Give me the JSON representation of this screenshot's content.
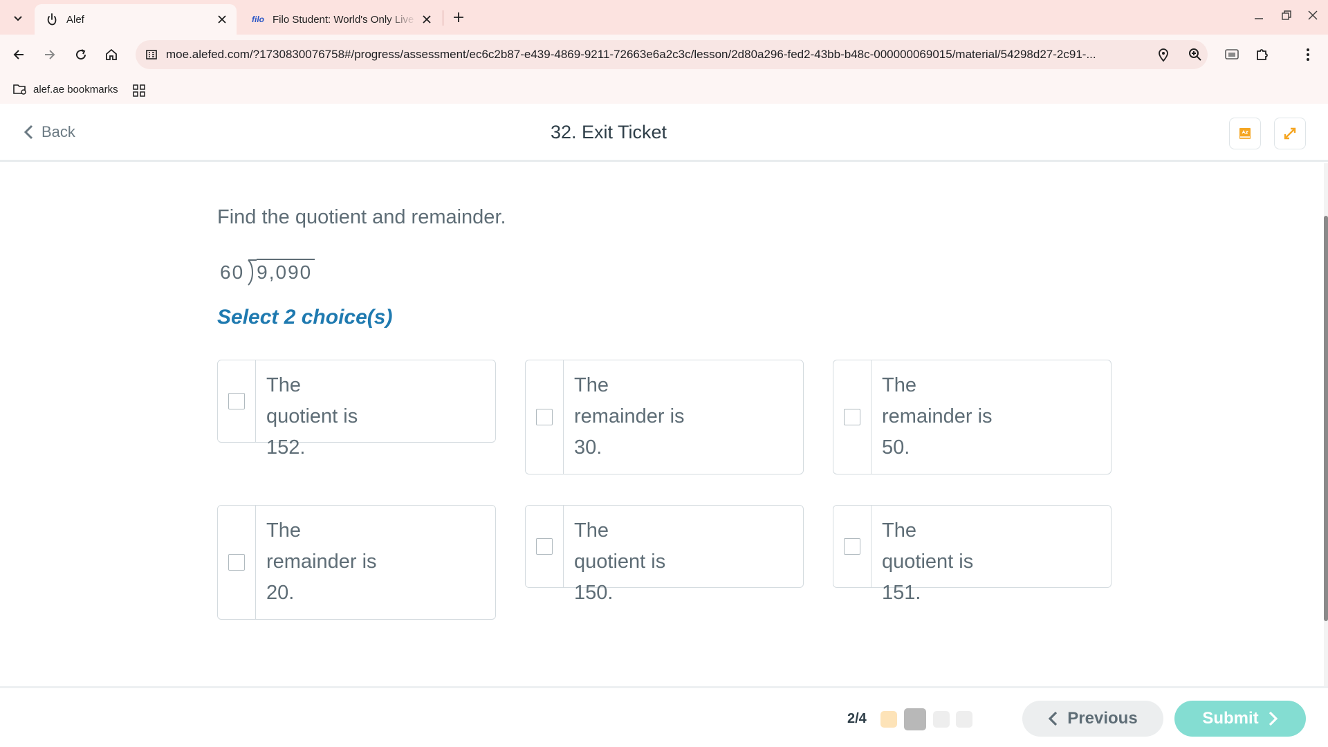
{
  "browser": {
    "tabs": [
      {
        "title": "Alef",
        "icon": "alef-favicon",
        "active": true
      },
      {
        "title": "Filo Student: World's Only Live Instant Tutoring",
        "icon": "filo-favicon",
        "favicon_text": "filo",
        "active": false
      }
    ],
    "url": "moe.alefed.com/?1730830076758#/progress/assessment/ec6c2b87-e439-4869-9211-72663e6a2c3c/lesson/2d80a296-fed2-43bb-b48c-000000069015/material/54298d27-2c91-...",
    "bookmarks": [
      {
        "label": "alef.ae bookmarks",
        "icon": "bookmark-folder-icon"
      }
    ]
  },
  "app": {
    "back_label": "Back",
    "title": "32. Exit Ticket",
    "toolbar_icons": [
      "glossary-icon",
      "fullscreen-icon"
    ]
  },
  "question": {
    "prompt": "Find the quotient and remainder.",
    "divisor": "60",
    "dividend": "9,090",
    "instruction": "Select 2 choice(s)",
    "choices": [
      {
        "text": "The quotient is 152.",
        "checked": false
      },
      {
        "text": "The remainder is 30.",
        "checked": false
      },
      {
        "text": "The remainder is 50.",
        "checked": false
      },
      {
        "text": "The remainder is 20.",
        "checked": false
      },
      {
        "text": "The quotient is 150.",
        "checked": false
      },
      {
        "text": "The quotient is 151.",
        "checked": false
      }
    ]
  },
  "footer": {
    "progress_text": "2/4",
    "progress_dots": [
      {
        "state": "answered",
        "color": "#fde3b8"
      },
      {
        "state": "current",
        "color": "#b8b8b8"
      },
      {
        "state": "pending",
        "color": "#eeeeee"
      },
      {
        "state": "pending",
        "color": "#eeeeee"
      }
    ],
    "previous_label": "Previous",
    "submit_label": "Submit"
  },
  "colors": {
    "accent_blue": "#1f7ab0",
    "submit_teal": "#84ddd2",
    "chrome_pink": "#fce3e0"
  }
}
